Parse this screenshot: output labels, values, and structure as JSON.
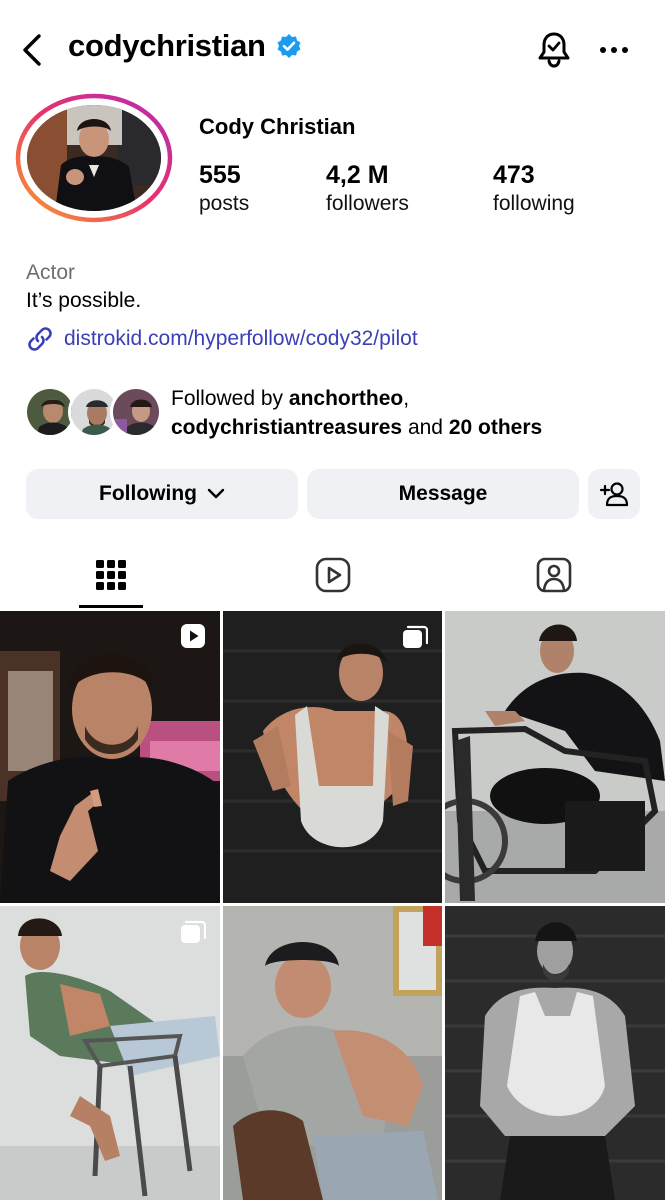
{
  "header": {
    "username": "codychristian",
    "verified": true
  },
  "profile": {
    "display_name": "Cody Christian",
    "stats": [
      {
        "value": "555",
        "label": "posts"
      },
      {
        "value": "4,2 M",
        "label": "followers"
      },
      {
        "value": "473",
        "label": "following"
      }
    ],
    "category": "Actor",
    "bio": "It’s possible.",
    "link": "distrokid.com/hyperfollow/cody32/pilot"
  },
  "followed_by": {
    "prefix": "Followed by ",
    "user1": "anchortheo",
    "comma": ",",
    "user2": "codychristiantreasures",
    "and": " and ",
    "others": "20 others"
  },
  "actions": {
    "following_label": "Following",
    "message_label": "Message"
  },
  "tabs": [
    {
      "icon": "grid-icon",
      "active": true
    },
    {
      "icon": "reels-icon",
      "active": false
    },
    {
      "icon": "tagged-icon",
      "active": false
    }
  ],
  "posts": [
    {
      "badge": "reel-icon"
    },
    {
      "badge": "carousel-icon"
    },
    {
      "badge": ""
    },
    {
      "badge": "carousel-icon"
    },
    {
      "badge": ""
    },
    {
      "badge": ""
    }
  ],
  "colors": {
    "link": "#3a3fb5",
    "verified": "#1d9bf0",
    "button_bg": "#eff1f4",
    "category": "#6e6e6e"
  }
}
